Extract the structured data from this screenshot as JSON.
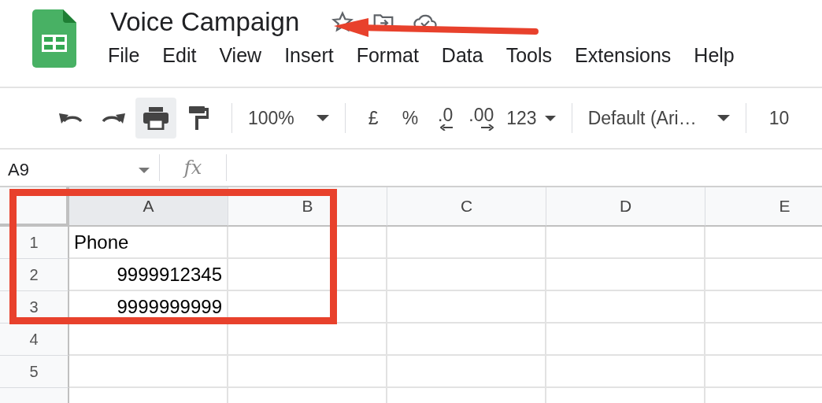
{
  "document": {
    "title": "Voice Campaign"
  },
  "menu": [
    "File",
    "Edit",
    "View",
    "Insert",
    "Format",
    "Data",
    "Tools",
    "Extensions",
    "Help"
  ],
  "tool_buttons": [
    {
      "kind": "undo",
      "active": false
    },
    {
      "kind": "redo",
      "active": false
    },
    {
      "kind": "print",
      "active": true
    },
    {
      "kind": "paint-format",
      "active": false
    }
  ],
  "toolbar": {
    "zoom": "100%",
    "currency": "£",
    "percent": "%",
    "decrease_decimals": ".0",
    "increase_decimals": ".00",
    "number_format": "123",
    "font": "Default (Ari…",
    "font_size": "10"
  },
  "formula_bar": {
    "cell_reference": "A9",
    "function_label": "fx"
  },
  "columns": [
    {
      "label": "A",
      "selected": true
    },
    {
      "label": "B",
      "selected": false
    },
    {
      "label": "C",
      "selected": false
    },
    {
      "label": "D",
      "selected": false
    },
    {
      "label": "E",
      "selected": false
    }
  ],
  "rows": [
    {
      "label": "1",
      "cells": [
        {
          "kind": "text",
          "value": "Phone"
        }
      ]
    },
    {
      "label": "2",
      "cells": [
        {
          "kind": "number",
          "value": "9999912345"
        }
      ]
    },
    {
      "label": "3",
      "cells": [
        {
          "kind": "number",
          "value": "9999999999"
        }
      ]
    },
    {
      "label": "4"
    },
    {
      "label": "5"
    }
  ]
}
